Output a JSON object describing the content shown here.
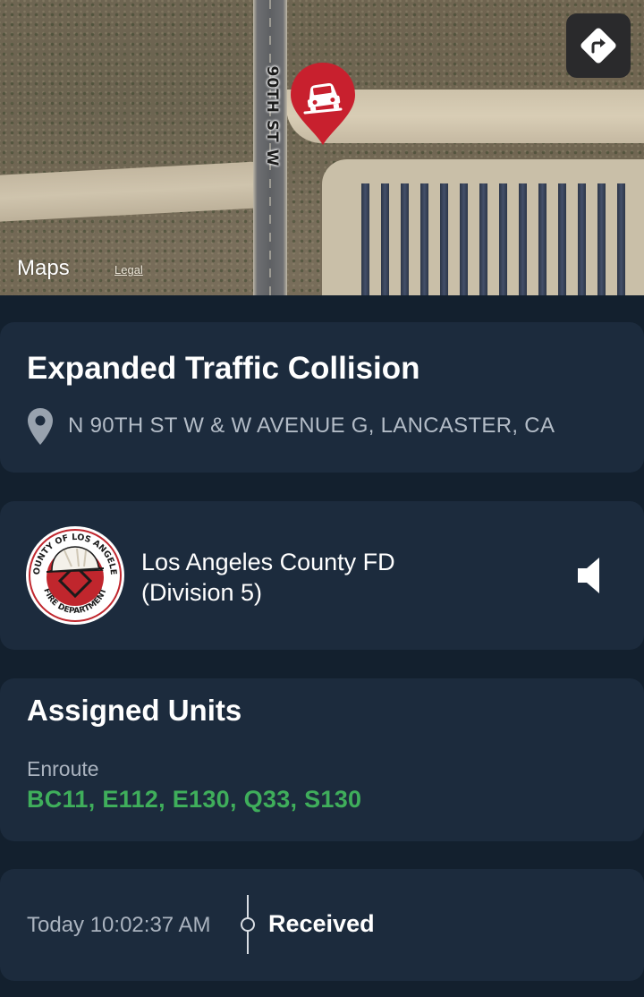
{
  "map": {
    "street_label": "90TH ST W",
    "brand_icon": "apple-logo",
    "brand_label": "Maps",
    "legal_label": "Legal",
    "pin_icon": "car-crash-icon",
    "directions_icon": "directions-icon"
  },
  "incident": {
    "title": "Expanded Traffic Collision",
    "location_icon": "location-pin-icon",
    "address": "N 90TH ST W & W AVENUE G, LANCASTER, CA"
  },
  "agency": {
    "logo": "county-of-los-angeles-fire-department-seal",
    "logo_text": "COUNTY OF LOS ANGELES FIRE DEPARTMENT",
    "name_line1": "Los Angeles County FD",
    "name_line2": "(Division 5)",
    "speaker_icon": "speaker-icon"
  },
  "units": {
    "title": "Assigned Units",
    "status": "Enroute",
    "list": "BC11, E112, E130, Q33, S130",
    "status_color": "#3fae5b"
  },
  "timeline": {
    "time": "Today 10:02:37 AM",
    "status": "Received"
  },
  "colors": {
    "background": "#13202e",
    "card": "#1c2b3d",
    "pin": "#c8202e"
  }
}
